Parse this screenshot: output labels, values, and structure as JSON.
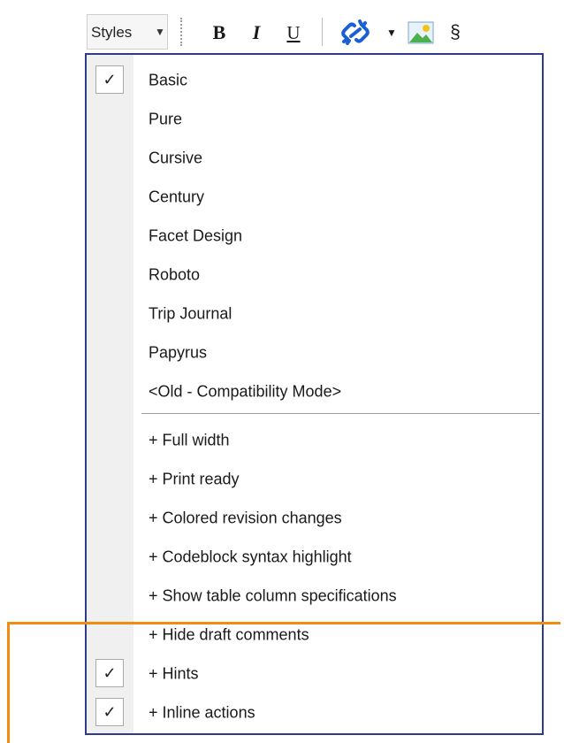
{
  "toolbar": {
    "styles_label": "Styles",
    "bold_label": "B",
    "italic_label": "I",
    "underline_label": "U",
    "section_label": "§",
    "icons": [
      "dropdown-arrow-icon",
      "link-icon",
      "image-icon"
    ]
  },
  "menu": {
    "styles": [
      {
        "label": "Basic",
        "checked": true
      },
      {
        "label": "Pure",
        "checked": false
      },
      {
        "label": "Cursive",
        "checked": false
      },
      {
        "label": "Century",
        "checked": false
      },
      {
        "label": "Facet Design",
        "checked": false
      },
      {
        "label": "Roboto",
        "checked": false
      },
      {
        "label": "Trip Journal",
        "checked": false
      },
      {
        "label": "Papyrus",
        "checked": false
      },
      {
        "label": "<Old - Compatibility Mode>",
        "checked": false
      }
    ],
    "options": [
      {
        "label": "+ Full width",
        "checked": false
      },
      {
        "label": "+ Print ready",
        "checked": false
      },
      {
        "label": "+ Colored revision changes",
        "checked": false
      },
      {
        "label": "+ Codeblock syntax highlight",
        "checked": false
      },
      {
        "label": "+ Show table column specifications",
        "checked": false
      },
      {
        "label": "+ Hide draft comments",
        "checked": false
      },
      {
        "label": "+ Hints",
        "checked": true
      },
      {
        "label": "+ Inline actions",
        "checked": true
      }
    ],
    "check_glyph": "✓"
  },
  "colors": {
    "menu_border": "#2e3a8c",
    "highlight": "#f28c10",
    "link_icon": "#1a5fd6"
  }
}
